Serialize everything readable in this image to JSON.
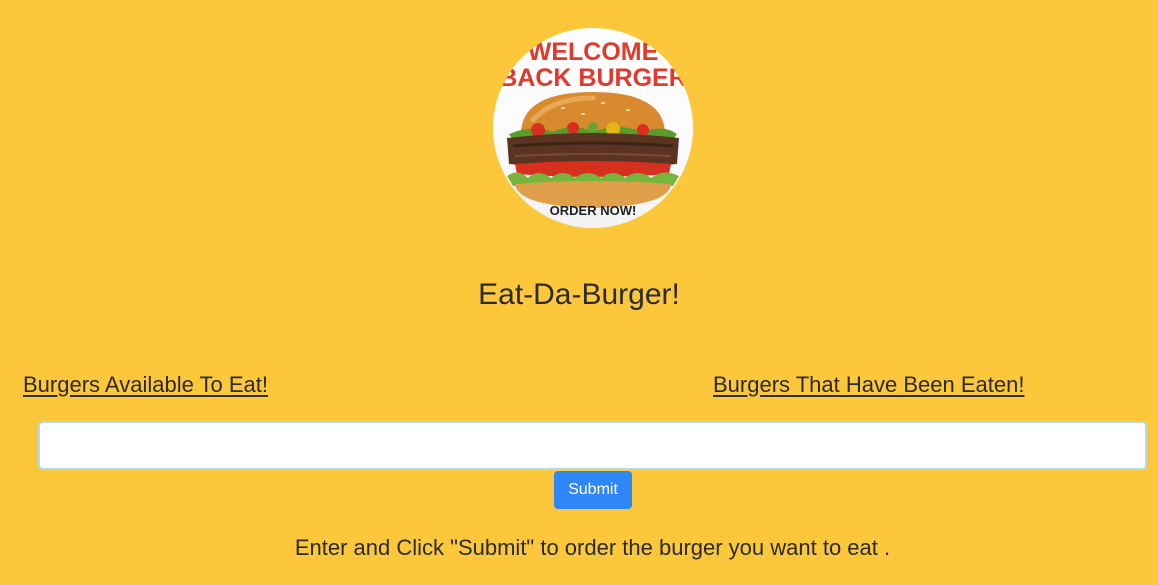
{
  "logo": {
    "line1": "WELCOME",
    "line2": "BACK BURGER",
    "footer": "ORDER NOW!",
    "icon": "burger-logo-icon"
  },
  "header": {
    "title": "Eat-Da-Burger!"
  },
  "columns": {
    "available": "Burgers Available To Eat!",
    "eaten": "Burgers That Have Been Eaten!"
  },
  "form": {
    "input_value": "",
    "input_placeholder": "",
    "submit_label": "Submit"
  },
  "instructions": "Enter and Click \"Submit\" to order the burger you want to eat .",
  "colors": {
    "background": "#fcc73a",
    "submit": "#2f86f6",
    "logo_text": "#e13a2d"
  }
}
